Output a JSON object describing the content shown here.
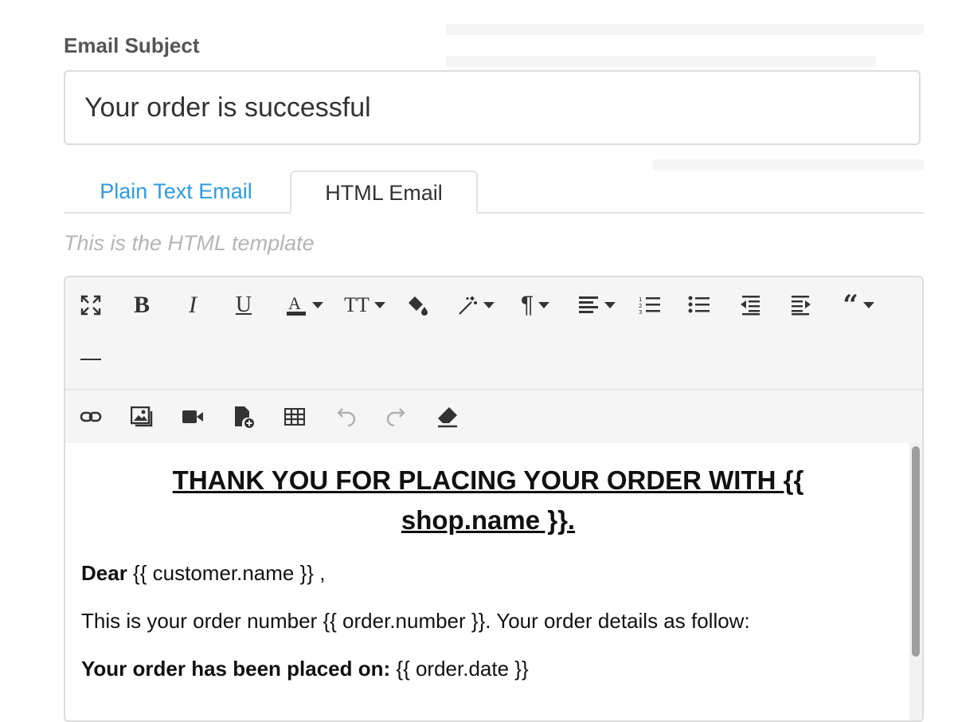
{
  "subject": {
    "label": "Email Subject",
    "value": "Your order is successful"
  },
  "tabs": [
    {
      "label": "Plain Text Email",
      "active": false
    },
    {
      "label": "HTML Email",
      "active": true
    }
  ],
  "template_hint": "This is the HTML template",
  "toolbar": {
    "row1": [
      "fullscreen-icon",
      "bold-icon",
      "italic-icon",
      "underline-icon",
      "font-color-icon",
      "font-size-icon",
      "paint-bucket-icon",
      "magic-wand-icon",
      "paragraph-icon",
      "align-icon",
      "ordered-list-icon",
      "unordered-list-icon",
      "outdent-icon",
      "indent-icon",
      "quote-icon",
      "horizontal-rule-icon"
    ],
    "row2": [
      "link-icon",
      "image-icon",
      "video-icon",
      "insert-file-icon",
      "table-icon",
      "undo-icon",
      "redo-icon",
      "eraser-icon"
    ]
  },
  "content": {
    "headline": "THANK YOU FOR PLACING YOUR ORDER WITH {{ shop.name }}.",
    "dear_label": "Dear",
    "dear_value": " {{ customer.name }} ,",
    "order_line": "This is your order number {{ order.number }}. Your order details as follow:",
    "placed_label": "Your order has been placed on:",
    "placed_value": " {{ order.date }}"
  },
  "colors": {
    "link": "#2f9be0",
    "border": "#dcdcdc",
    "toolbar_bg": "#f5f5f5",
    "hint": "#b5b5b5"
  }
}
